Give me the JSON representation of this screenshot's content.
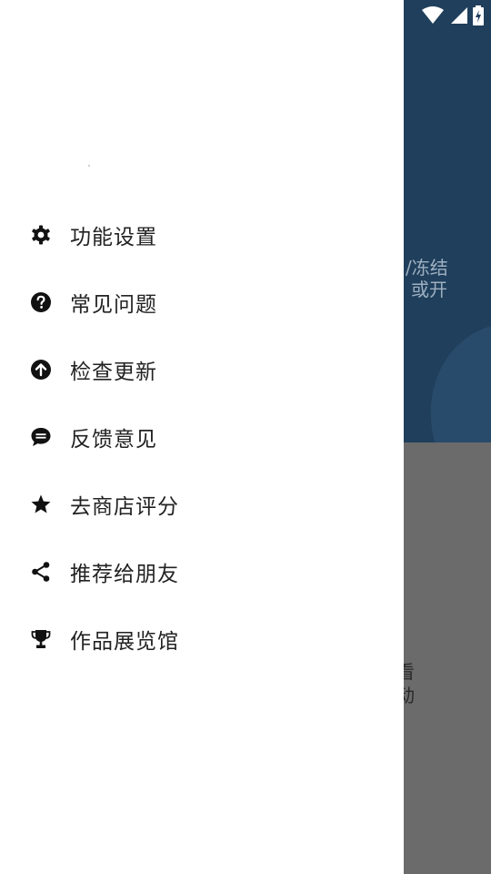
{
  "background": {
    "header_text_line1": "/冻结",
    "header_text_line2": "或开",
    "body_text_line1": "看",
    "body_text_line2": "动"
  },
  "status_bar": {
    "icons": [
      "wifi-icon",
      "cell-signal-icon",
      "battery-charging-icon"
    ]
  },
  "drawer": {
    "items": [
      {
        "label": "功能设置",
        "icon": "gear-icon"
      },
      {
        "label": "常见问题",
        "icon": "help-icon"
      },
      {
        "label": "检查更新",
        "icon": "upgrade-icon"
      },
      {
        "label": "反馈意见",
        "icon": "feedback-icon"
      },
      {
        "label": "去商店评分",
        "icon": "star-icon"
      },
      {
        "label": "推荐给朋友",
        "icon": "share-icon"
      },
      {
        "label": "作品展览馆",
        "icon": "trophy-icon"
      }
    ]
  },
  "colors": {
    "header_bg": "#1f3f5c",
    "scrim": "#6b6b6b",
    "drawer_bg": "#ffffff",
    "icon": "#111111",
    "text": "#222222"
  }
}
